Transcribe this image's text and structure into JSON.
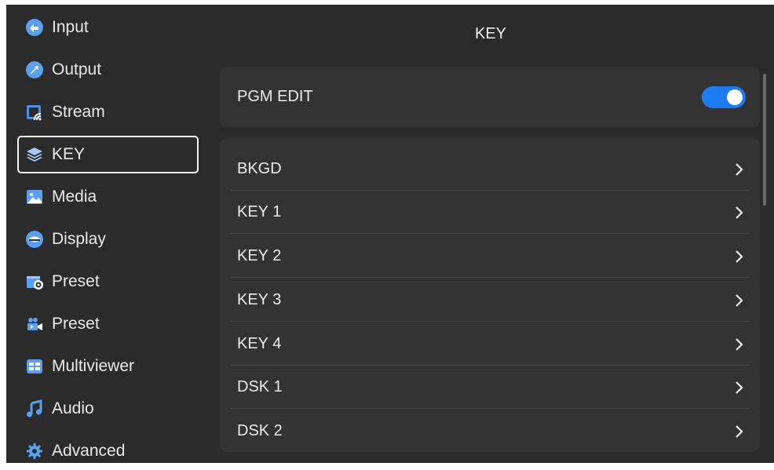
{
  "colors": {
    "background": "#2b2b2b",
    "card": "#333333",
    "accent": "#1a7cf0"
  },
  "sidebar": {
    "items": [
      {
        "label": "Input",
        "icon": "input-icon"
      },
      {
        "label": "Output",
        "icon": "output-icon"
      },
      {
        "label": "Stream",
        "icon": "stream-icon"
      },
      {
        "label": "KEY",
        "icon": "layers-icon",
        "active": true
      },
      {
        "label": "Media",
        "icon": "media-icon"
      },
      {
        "label": "Display",
        "icon": "display-icon"
      },
      {
        "label": "Preset",
        "icon": "preset-icon"
      },
      {
        "label": "Preset",
        "icon": "preset-camera-icon"
      },
      {
        "label": "Multiviewer",
        "icon": "multiviewer-icon"
      },
      {
        "label": "Audio",
        "icon": "audio-icon"
      },
      {
        "label": "Advanced",
        "icon": "advanced-icon"
      }
    ]
  },
  "main": {
    "title": "KEY",
    "pgm_edit": {
      "label": "PGM EDIT",
      "enabled": true
    },
    "rows": [
      {
        "label": "BKGD"
      },
      {
        "label": "KEY 1"
      },
      {
        "label": "KEY 2"
      },
      {
        "label": "KEY 3"
      },
      {
        "label": "KEY 4"
      },
      {
        "label": "DSK 1"
      },
      {
        "label": "DSK 2"
      }
    ]
  }
}
